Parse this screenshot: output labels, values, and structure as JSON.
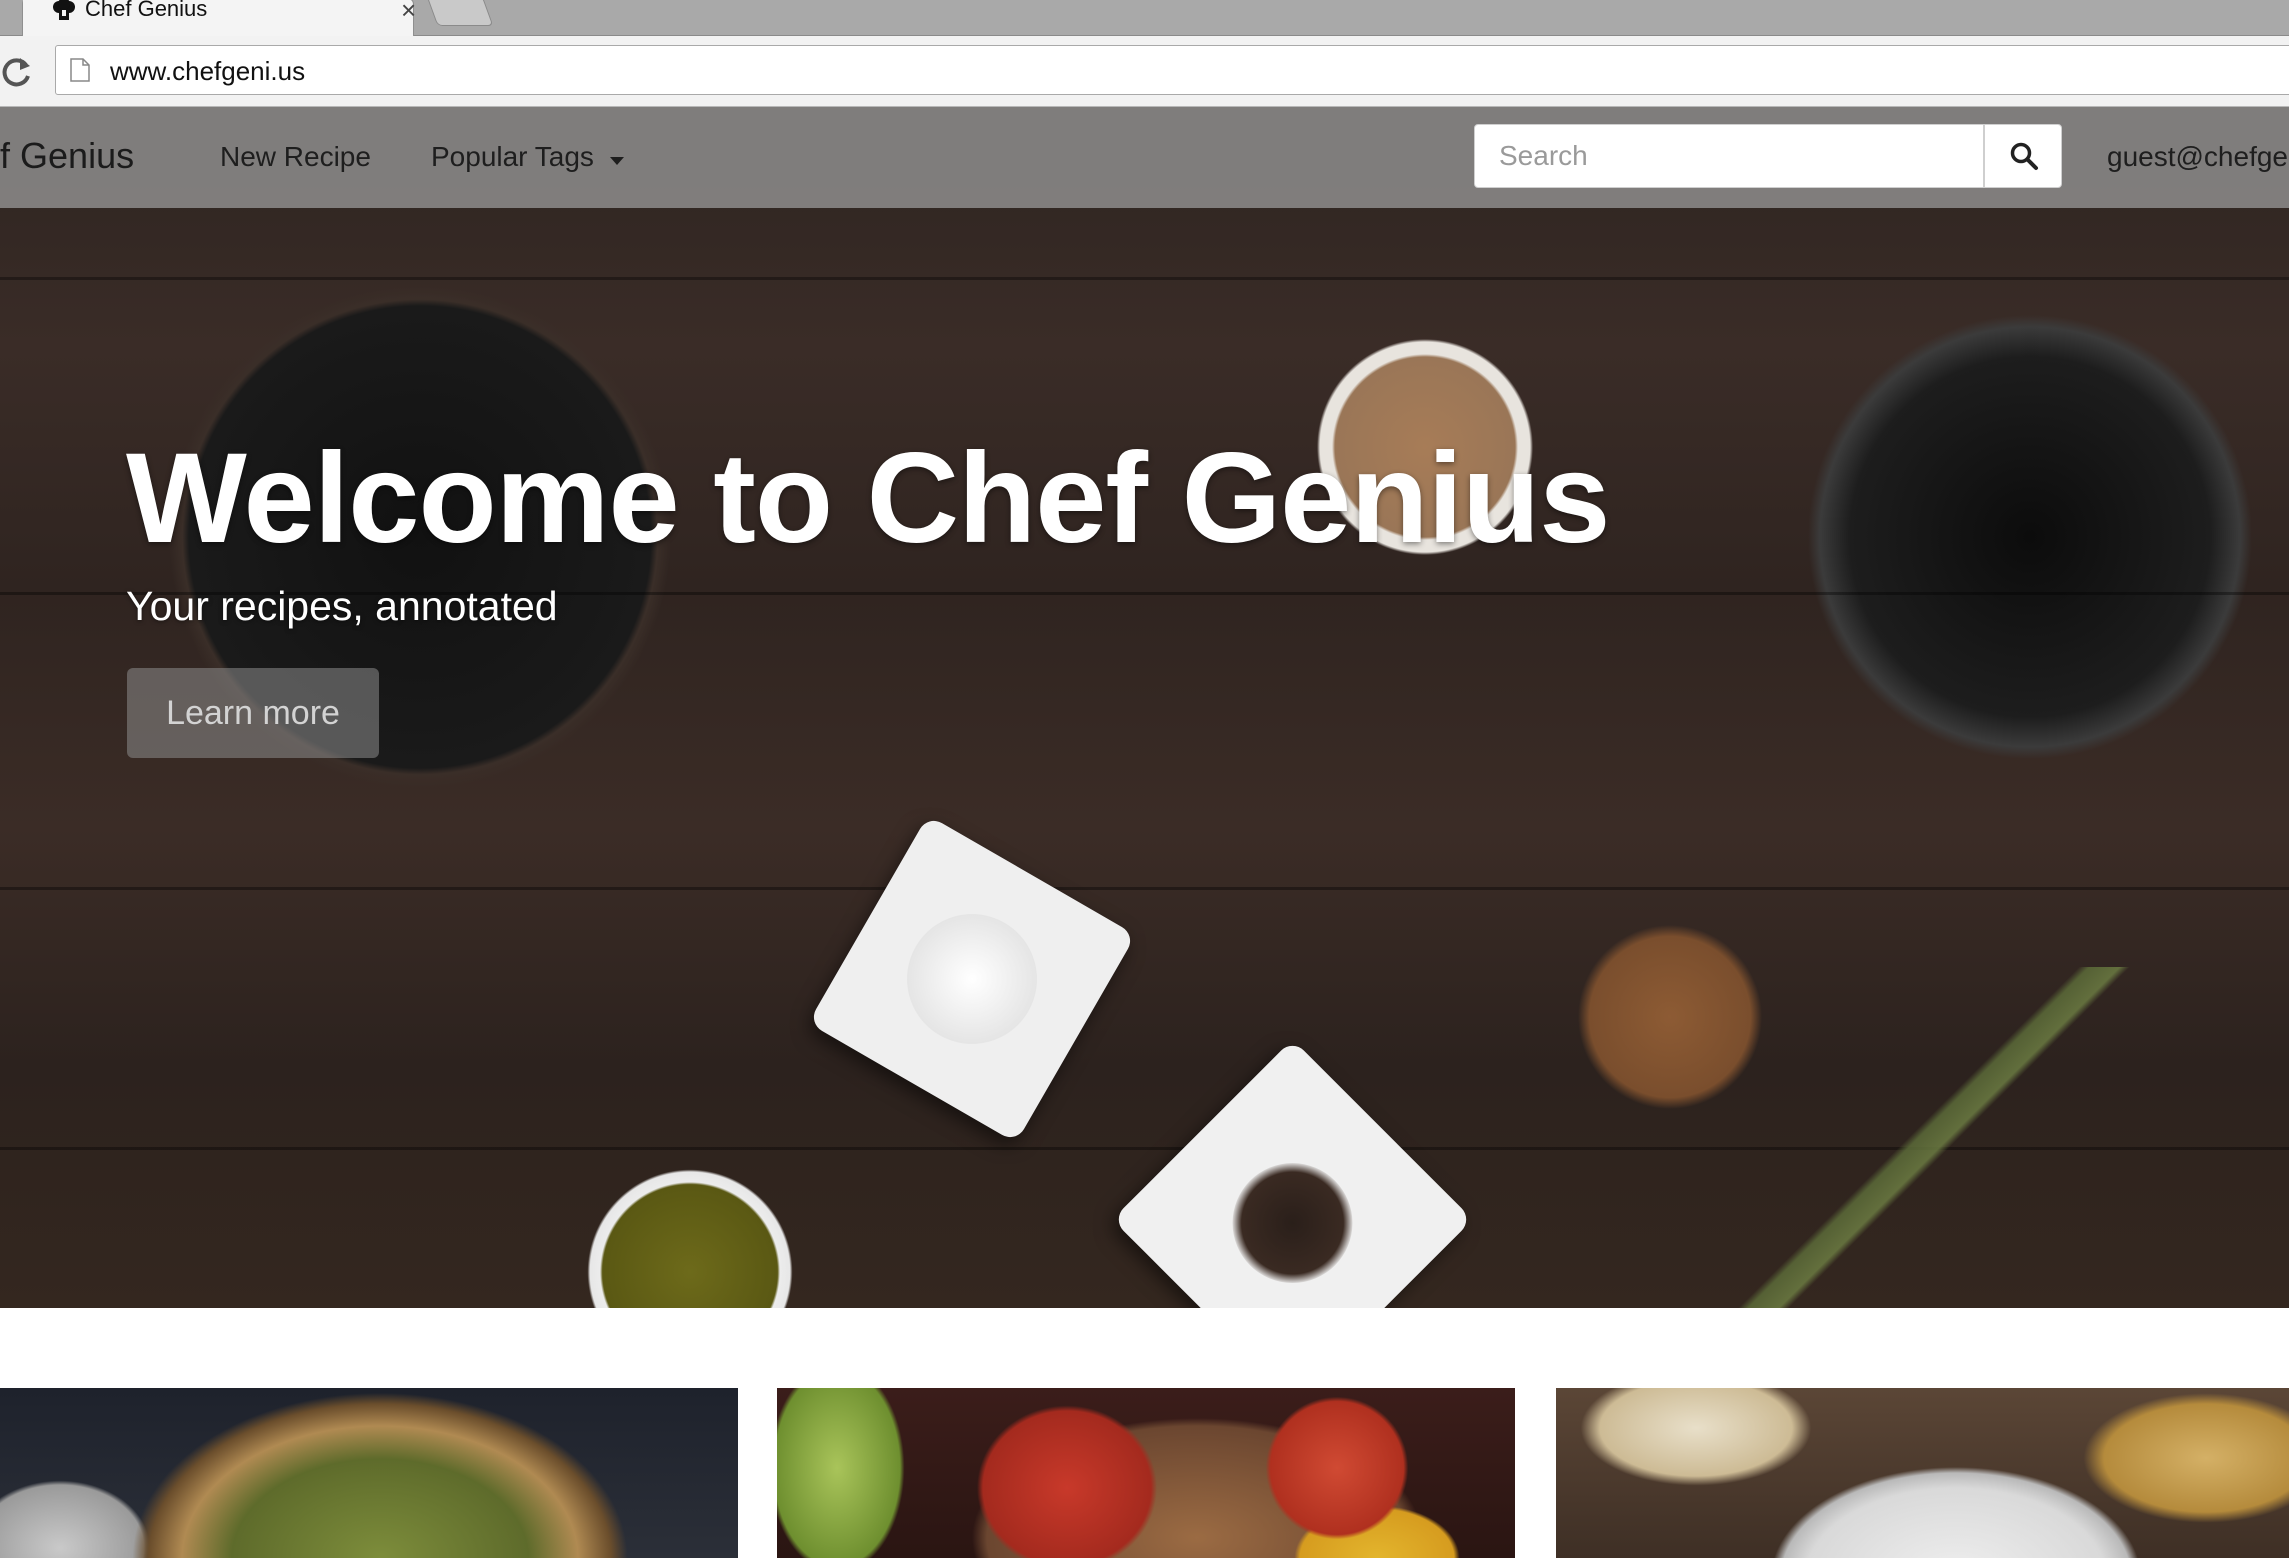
{
  "browser": {
    "tab_title": "Chef Genius",
    "tab_close": "×",
    "url": "www.chefgeni.us"
  },
  "navbar": {
    "brand": "ef Genius",
    "new_recipe": "New Recipe",
    "popular_tags": "Popular Tags",
    "search_placeholder": "Search",
    "user": "guest@chefge"
  },
  "hero": {
    "title": "Welcome to Chef Genius",
    "subtitle": "Your recipes, annotated",
    "button": "Learn more"
  },
  "cards": [
    {
      "image": "quiche-image"
    },
    {
      "image": "tomato-toast-image"
    },
    {
      "image": "noodle-bowl-image"
    }
  ],
  "colors": {
    "navbar_bg": "#969696",
    "hero_text": "#ffffff",
    "button_bg": "#8c8c8c"
  }
}
